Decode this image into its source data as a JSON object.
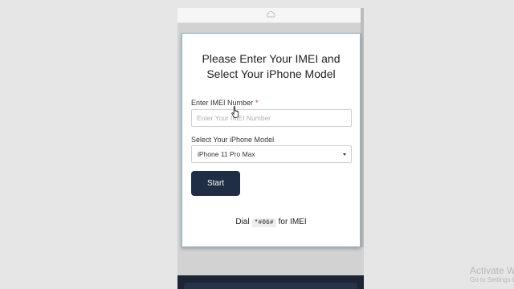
{
  "form": {
    "title_line1": "Please Enter Your IMEI and",
    "title_line2": "Select Your iPhone Model",
    "imei_label": "Enter IMEI Number",
    "required_mark": "*",
    "imei_placeholder": "Enter Your IMEI Number",
    "model_label": "Select Your iPhone Model",
    "model_selected": "iPhone 11 Pro Max",
    "start_label": "Start",
    "dial_prefix": "Dial",
    "dial_code": "*#06#",
    "dial_suffix": "for IMEI"
  },
  "watermark": {
    "title": "Activate Windows",
    "subtitle": "Go to Settings to activate Windows."
  },
  "colors": {
    "button": "#1f2e45",
    "card_border": "#8fb3c9",
    "required": "#d9342b"
  },
  "icons": [
    "cloud-icon",
    "hand-cursor-icon",
    "chevron-down-icon"
  ]
}
